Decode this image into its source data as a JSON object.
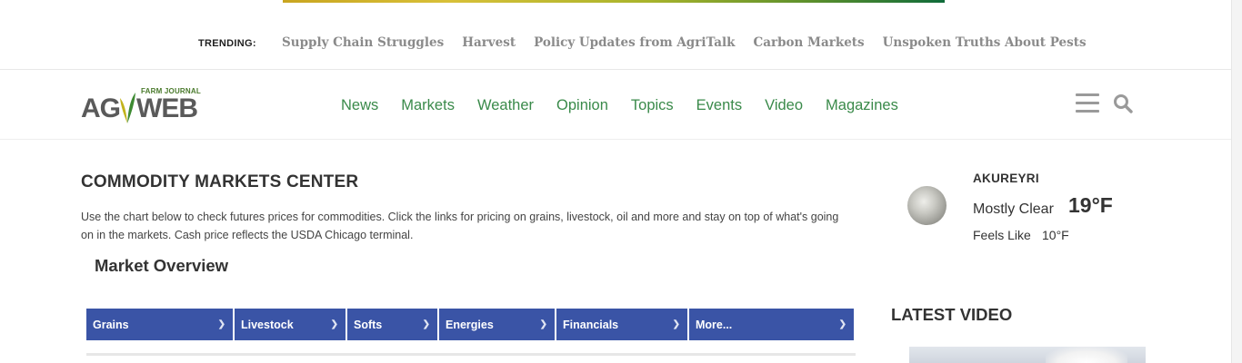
{
  "trending": {
    "label": "TRENDING:",
    "items": [
      "Supply Chain Struggles",
      "Harvest",
      "Policy Updates from AgriTalk",
      "Carbon Markets",
      "Unspoken Truths About Pests"
    ]
  },
  "logo": {
    "farm_journal": "FARM JOURNAL",
    "ag": "AG",
    "web": "WEB"
  },
  "nav": {
    "items": [
      "News",
      "Markets",
      "Weather",
      "Opinion",
      "Topics",
      "Events",
      "Video",
      "Magazines"
    ]
  },
  "icons": {
    "menu": "hamburger-menu-icon",
    "search": "search-icon"
  },
  "colors": {
    "nav_green": "#3a8a4a",
    "tab_blue": "#3a54a6",
    "trending_gray": "#8a8a8a"
  },
  "main": {
    "title": "COMMODITY MARKETS CENTER",
    "intro": "Use the chart below to check futures prices for commodities. Click the links for pricing on grains, livestock, oil and more and stay on top of what's going on in the markets. Cash price reflects the USDA Chicago terminal.",
    "section_title": "Market Overview",
    "tabs": [
      {
        "label": "Grains"
      },
      {
        "label": "Livestock"
      },
      {
        "label": "Softs"
      },
      {
        "label": "Energies"
      },
      {
        "label": "Financials"
      },
      {
        "label": "More..."
      }
    ]
  },
  "weather": {
    "city": "AKUREYRI",
    "condition": "Mostly Clear",
    "temp": "19°F",
    "feels_label": "Feels Like",
    "feels_value": "10°F"
  },
  "sidebar": {
    "latest_video_title": "LATEST VIDEO"
  }
}
